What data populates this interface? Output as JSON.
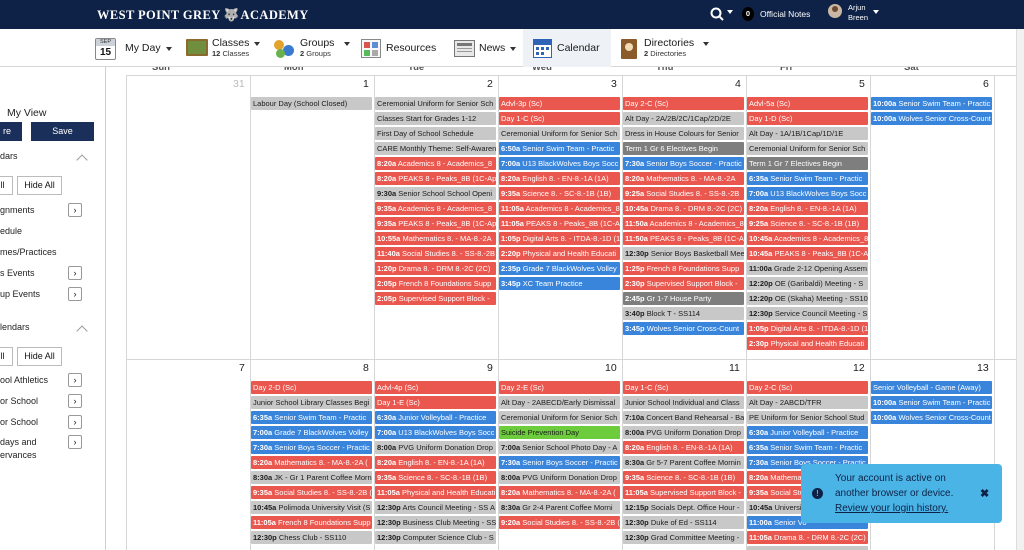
{
  "app": {
    "brand_left": "WEST POINT GREY",
    "brand_right": "ACADEMY"
  },
  "topbar": {
    "notes_count": "0",
    "notes_label": "Official Notes",
    "user_first": "Arjun",
    "user_last": "Breen"
  },
  "nav": {
    "date_month": "SEP",
    "date_day": "15",
    "my_day": "My Day",
    "classes": "Classes",
    "classes_count": "12",
    "classes_unit": "Classes",
    "groups": "Groups",
    "groups_count": "2",
    "groups_unit": "Groups",
    "resources": "Resources",
    "news": "News",
    "calendar": "Calendar",
    "directories": "Directories",
    "directories_count": "2",
    "directories_unit": "Directories"
  },
  "sidebar": {
    "my_view": "My View",
    "more_btn": "re",
    "save_btn": "Save",
    "calendars_heading": "dars",
    "all_btn_1": "ll",
    "hide_all_1": "Hide All",
    "items_a": [
      "gnments",
      "edule",
      "mes/Practices",
      "s Events",
      "up Events"
    ],
    "calendars_heading_2": "lendars",
    "all_btn_2": "ll",
    "hide_all_2": "Hide All",
    "items_b": [
      "ool Athletics",
      "or School",
      "or School",
      "days and",
      "ervances"
    ]
  },
  "calendar": {
    "weekdays": [
      "Sun",
      "Mon",
      "Tue",
      "Wed",
      "Thu",
      "Fri",
      "Sat"
    ],
    "week1_days": [
      "31",
      "1",
      "2",
      "3",
      "4",
      "5",
      "6"
    ],
    "week2_days": [
      "7",
      "8",
      "9",
      "10",
      "11",
      "12",
      "13"
    ],
    "week1": [
      [],
      [
        {
          "time": "",
          "title": "Labour Day (School Closed)",
          "color": "grey"
        }
      ],
      [
        {
          "time": "",
          "title": "Ceremonial Uniform for Senior Sch",
          "color": "grey"
        },
        {
          "time": "",
          "title": "Classes Start for Grades 1-12",
          "color": "grey"
        },
        {
          "time": "",
          "title": "First Day of School Schedule",
          "color": "grey"
        },
        {
          "time": "",
          "title": "CARE Monthly Theme: Self-Awaren",
          "color": "grey"
        },
        {
          "time": "8:20a",
          "title": "Academics 8 - Academics_8",
          "color": "red"
        },
        {
          "time": "8:20a",
          "title": "PEAKS 8 - Peaks_8B (1C-Ap)",
          "color": "red"
        },
        {
          "time": "9:30a",
          "title": "Senior School School Openi",
          "color": "grey"
        },
        {
          "time": "9:35a",
          "title": "Academics 8 - Academics_8",
          "color": "red"
        },
        {
          "time": "9:35a",
          "title": "PEAKS 8 - Peaks_8B (1C-Ap)",
          "color": "red"
        },
        {
          "time": "10:55a",
          "title": "Mathematics 8. - MA-8.-2A",
          "color": "red"
        },
        {
          "time": "11:40a",
          "title": "Social Studies 8. - SS-8.-2B",
          "color": "red"
        },
        {
          "time": "1:20p",
          "title": "Drama 8. - DRM 8.-2C (2C)",
          "color": "red"
        },
        {
          "time": "2:05p",
          "title": "French 8 Foundations Supp",
          "color": "red"
        },
        {
          "time": "2:05p",
          "title": "Supervised Support Block -",
          "color": "red"
        }
      ],
      [
        {
          "time": "",
          "title": "Advl-3p (Sc)",
          "color": "red"
        },
        {
          "time": "",
          "title": "Day 1-C (Sc)",
          "color": "red"
        },
        {
          "time": "",
          "title": "Ceremonial Uniform for Senior Sch",
          "color": "grey"
        },
        {
          "time": "6:50a",
          "title": "Senior Swim Team - Practic",
          "color": "blue"
        },
        {
          "time": "7:00a",
          "title": "U13 BlackWolves Boys Socc",
          "color": "blue"
        },
        {
          "time": "8:20a",
          "title": "English 8. - EN-8.-1A (1A)",
          "color": "red"
        },
        {
          "time": "9:35a",
          "title": "Science 8. - SC-8.-1B (1B)",
          "color": "red"
        },
        {
          "time": "11:05a",
          "title": "Academics 8 - Academics_8",
          "color": "red"
        },
        {
          "time": "11:05a",
          "title": "PEAKS 8 - Peaks_8B (1C-Ap)",
          "color": "red"
        },
        {
          "time": "1:05p",
          "title": "Digital Arts 8. - ITDA-8.-1D (1",
          "color": "red"
        },
        {
          "time": "2:20p",
          "title": "Physical and Health Educati",
          "color": "red"
        },
        {
          "time": "2:35p",
          "title": "Grade 7 BlackWolves Volley",
          "color": "blue"
        },
        {
          "time": "3:45p",
          "title": "XC Team Practice",
          "color": "blue"
        }
      ],
      [
        {
          "time": "",
          "title": "Day 2-C (Sc)",
          "color": "red"
        },
        {
          "time": "",
          "title": "Alt Day - 2A/2B/2C/1Cap/2D/2E",
          "color": "grey"
        },
        {
          "time": "",
          "title": "Dress in House Colours for Senior",
          "color": "grey"
        },
        {
          "time": "",
          "title": "Term 1 Gr 6 Electives Begin",
          "color": "dgrey"
        },
        {
          "time": "7:30a",
          "title": "Senior Boys Soccer - Practic",
          "color": "blue"
        },
        {
          "time": "8:20a",
          "title": "Mathematics 8. - MA-8.-2A",
          "color": "red"
        },
        {
          "time": "9:25a",
          "title": "Social Studies 8. - SS-8.-2B",
          "color": "red"
        },
        {
          "time": "10:45a",
          "title": "Drama 8. - DRM 8.-2C (2C)",
          "color": "red"
        },
        {
          "time": "11:50a",
          "title": "Academics 8 - Academics_8",
          "color": "red"
        },
        {
          "time": "11:50a",
          "title": "PEAKS 8 - Peaks_8B (1C-Ap)",
          "color": "red"
        },
        {
          "time": "12:30p",
          "title": "Senior Boys Basketball Mee",
          "color": "grey"
        },
        {
          "time": "1:25p",
          "title": "French 8 Foundations Supp",
          "color": "red"
        },
        {
          "time": "2:30p",
          "title": "Supervised Support Block -",
          "color": "red"
        },
        {
          "time": "2:45p",
          "title": "Gr 1-7 House Party",
          "color": "dgrey"
        },
        {
          "time": "3:40p",
          "title": "Block T - SS114",
          "color": "grey"
        },
        {
          "time": "3:45p",
          "title": "Wolves Senior Cross-Count",
          "color": "blue"
        }
      ],
      [
        {
          "time": "",
          "title": "Advl-5a (Sc)",
          "color": "red"
        },
        {
          "time": "",
          "title": "Day 1-D (Sc)",
          "color": "red"
        },
        {
          "time": "",
          "title": "Alt Day - 1A/1B/1Cap/1D/1E",
          "color": "grey"
        },
        {
          "time": "",
          "title": "Ceremonial Uniform for Senior Sch",
          "color": "grey"
        },
        {
          "time": "",
          "title": "Term 1 Gr 7 Electives Begin",
          "color": "dgrey"
        },
        {
          "time": "6:35a",
          "title": "Senior Swim Team - Practic",
          "color": "blue"
        },
        {
          "time": "7:00a",
          "title": "U13 BlackWolves Boys Socc",
          "color": "blue"
        },
        {
          "time": "8:20a",
          "title": "English 8. - EN-8.-1A (1A)",
          "color": "red"
        },
        {
          "time": "9:25a",
          "title": "Science 8. - SC-8.-1B (1B)",
          "color": "red"
        },
        {
          "time": "10:45a",
          "title": "Academics 8 - Academics_8",
          "color": "red"
        },
        {
          "time": "10:45a",
          "title": "PEAKS 8 - Peaks_8B (1C-Ap)",
          "color": "red"
        },
        {
          "time": "11:00a",
          "title": "Grade 2-12 Opening Assem",
          "color": "grey"
        },
        {
          "time": "12:20p",
          "title": "OE (Garibaldi) Meeting - S",
          "color": "grey"
        },
        {
          "time": "12:20p",
          "title": "OE (Skaha) Meeting - SS108",
          "color": "grey"
        },
        {
          "time": "12:30p",
          "title": "Service Council Meeting - S",
          "color": "grey"
        },
        {
          "time": "1:05p",
          "title": "Digital Arts 8. - ITDA-8.-1D (1",
          "color": "red"
        },
        {
          "time": "2:30p",
          "title": "Physical and Health Educati",
          "color": "red"
        }
      ],
      [
        {
          "time": "10:00a",
          "title": "Senior Swim Team - Practic",
          "color": "blue"
        },
        {
          "time": "10:00a",
          "title": "Wolves Senior Cross-Count",
          "color": "blue"
        }
      ]
    ],
    "week2": [
      [],
      [
        {
          "time": "",
          "title": "Day 2-D (Sc)",
          "color": "red"
        },
        {
          "time": "",
          "title": "Junior School Library Classes Begi",
          "color": "grey"
        },
        {
          "time": "6:35a",
          "title": "Senior Swim Team - Practic",
          "color": "blue"
        },
        {
          "time": "7:00a",
          "title": "Grade 7 BlackWolves Volley",
          "color": "blue"
        },
        {
          "time": "7:30a",
          "title": "Senior Boys Soccer - Practic",
          "color": "blue"
        },
        {
          "time": "8:20a",
          "title": "Mathematics 8. - MA-8.-2A (",
          "color": "red"
        },
        {
          "time": "8:30a",
          "title": "JK - Gr 1 Parent Coffee Morn",
          "color": "grey"
        },
        {
          "time": "9:35a",
          "title": "Social Studies 8. - SS-8.-2B (",
          "color": "red"
        },
        {
          "time": "10:45a",
          "title": "Polimoda University Visit (S",
          "color": "grey"
        },
        {
          "time": "11:05a",
          "title": "French 8 Foundations Supp",
          "color": "red"
        },
        {
          "time": "12:30p",
          "title": "Chess Club - SS110",
          "color": "grey"
        }
      ],
      [
        {
          "time": "",
          "title": "Advl-4p (Sc)",
          "color": "red"
        },
        {
          "time": "",
          "title": "Day 1-E (Sc)",
          "color": "red"
        },
        {
          "time": "6:30a",
          "title": "Junior Volleyball - Practice",
          "color": "blue"
        },
        {
          "time": "7:00a",
          "title": "U13 BlackWolves Boys Socc",
          "color": "blue"
        },
        {
          "time": "8:00a",
          "title": "PVG Uniform Donation Drop",
          "color": "grey"
        },
        {
          "time": "8:20a",
          "title": "English 8. - EN-8.-1A (1A)",
          "color": "red"
        },
        {
          "time": "9:35a",
          "title": "Science 8. - SC-8.-1B (1B)",
          "color": "red"
        },
        {
          "time": "11:05a",
          "title": "Physical and Health Educati",
          "color": "red"
        },
        {
          "time": "12:30p",
          "title": "Arts Council Meeting - SS A",
          "color": "grey"
        },
        {
          "time": "12:30p",
          "title": "Business Club Meeting - SS",
          "color": "grey"
        },
        {
          "time": "12:30p",
          "title": "Computer Science Club - S",
          "color": "grey"
        }
      ],
      [
        {
          "time": "",
          "title": "Day 2-E (Sc)",
          "color": "red"
        },
        {
          "time": "",
          "title": "Alt Day - 2ABECD/Early Dismissal",
          "color": "grey"
        },
        {
          "time": "",
          "title": "Ceremonial Uniform for Senior Sch",
          "color": "grey"
        },
        {
          "time": "",
          "title": "Suicide Prevention Day",
          "color": "green"
        },
        {
          "time": "7:00a",
          "title": "Senior School Photo Day - A",
          "color": "grey"
        },
        {
          "time": "7:30a",
          "title": "Senior Boys Soccer - Practic",
          "color": "blue"
        },
        {
          "time": "8:00a",
          "title": "PVG Uniform Donation Drop",
          "color": "grey"
        },
        {
          "time": "8:20a",
          "title": "Mathematics 8. - MA-8.-2A (",
          "color": "red"
        },
        {
          "time": "8:30a",
          "title": "Gr 2-4 Parent Coffee Morni",
          "color": "grey"
        },
        {
          "time": "9:20a",
          "title": "Social Studies 8. - SS-8.-2B (",
          "color": "red"
        }
      ],
      [
        {
          "time": "",
          "title": "Day 1-C (Sc)",
          "color": "red"
        },
        {
          "time": "",
          "title": "Junior School Individual and Class",
          "color": "grey"
        },
        {
          "time": "7:10a",
          "title": "Concert Band Rehearsal - Ba",
          "color": "grey"
        },
        {
          "time": "8:00a",
          "title": "PVG Uniform Donation Drop",
          "color": "grey"
        },
        {
          "time": "8:20a",
          "title": "English 8. - EN-8.-1A (1A)",
          "color": "red"
        },
        {
          "time": "8:30a",
          "title": "Gr 5-7 Parent Coffee Mornin",
          "color": "grey"
        },
        {
          "time": "9:35a",
          "title": "Science 8. - SC-8.-1B (1B)",
          "color": "red"
        },
        {
          "time": "11:05a",
          "title": "Supervised Support Block -",
          "color": "red"
        },
        {
          "time": "12:15p",
          "title": "Socials Dept. Office Hour -",
          "color": "grey"
        },
        {
          "time": "12:30p",
          "title": "Duke of Ed - SS114",
          "color": "grey"
        },
        {
          "time": "12:30p",
          "title": "Grad Committee Meeting -",
          "color": "grey"
        }
      ],
      [
        {
          "time": "",
          "title": "Day 2-C (Sc)",
          "color": "red"
        },
        {
          "time": "",
          "title": "Alt Day - 2ABCD/TFR",
          "color": "grey"
        },
        {
          "time": "",
          "title": "PE Uniform for Senior School Stud",
          "color": "grey"
        },
        {
          "time": "6:30a",
          "title": "Junior Volleyball - Practice",
          "color": "blue"
        },
        {
          "time": "6:35a",
          "title": "Senior Swim Team - Practic",
          "color": "blue"
        },
        {
          "time": "7:30a",
          "title": "Senior Boys Soccer - Practic",
          "color": "blue"
        },
        {
          "time": "8:20a",
          "title": "Mathematic",
          "color": "red"
        },
        {
          "time": "9:35a",
          "title": "Social Stu",
          "color": "red"
        },
        {
          "time": "10:45a",
          "title": "Universit",
          "color": "grey"
        },
        {
          "time": "11:00a",
          "title": "Senior Vo",
          "color": "blue"
        },
        {
          "time": "11:05a",
          "title": "Drama 8. - DRM 8.-2C (2C)",
          "color": "red"
        },
        {
          "time": "12:30p",
          "title": "",
          "color": "grey"
        }
      ],
      [
        {
          "time": "",
          "title": "Senior Volleyball - Game (Away)",
          "color": "blue"
        },
        {
          "time": "10:00a",
          "title": "Senior Swim Team - Practic",
          "color": "blue"
        },
        {
          "time": "10:00a",
          "title": "Wolves Senior Cross-Count",
          "color": "blue"
        }
      ]
    ]
  },
  "colors": {
    "red": "#ea574e",
    "blue": "#3a85dc",
    "grey": "#c8c8c8",
    "dgrey": "#7e7e7e",
    "green": "#6dcc3c",
    "navy": "#0d2246",
    "toast": "#4bb4e6"
  },
  "toast": {
    "line1": "Your account is active on",
    "line2": "another browser or device.",
    "link": "Review your login history.",
    "close": "✖"
  }
}
